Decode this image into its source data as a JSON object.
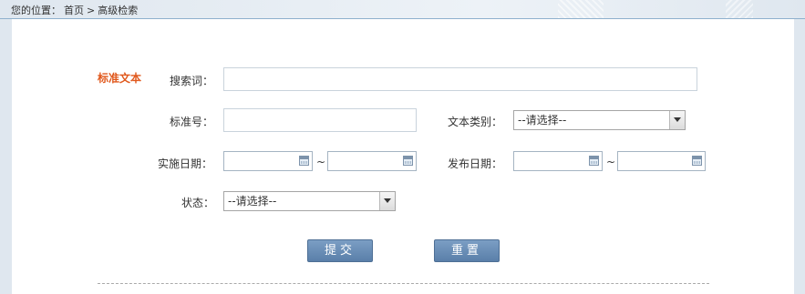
{
  "breadcrumb": {
    "prefix": "您的位置：",
    "home": "首页",
    "sep": ">",
    "current": "高级检索"
  },
  "section_title": "标准文本",
  "form": {
    "keyword_label": "搜索词：",
    "keyword_value": "",
    "std_no_label": "标准号：",
    "std_no_value": "",
    "doc_type_label": "文本类别：",
    "doc_type_selected": "--请选择--",
    "impl_date_label": "实施日期：",
    "publish_date_label": "发布日期：",
    "range_sep": "~",
    "status_label": "状态：",
    "status_selected": "--请选择--"
  },
  "buttons": {
    "submit": "提交",
    "reset": "重置"
  },
  "colors": {
    "section_title": "#e0581c",
    "button": "#5a7fa9",
    "topbar_border": "#8eb0cd"
  },
  "icons": {
    "date_picker": "calendar-icon",
    "select": "chevron-down-icon"
  }
}
